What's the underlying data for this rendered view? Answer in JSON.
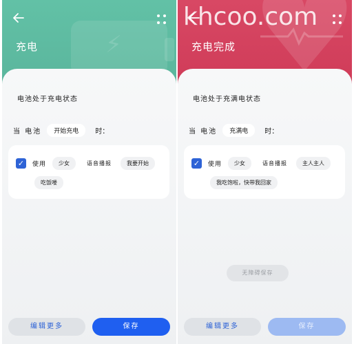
{
  "screens": [
    {
      "title": "充电",
      "state_text": "电池处于充电状态",
      "condition": {
        "prefix": "当 电池",
        "value": "开始充电",
        "suffix": "时："
      },
      "action": {
        "checked": true,
        "use_label": "使用",
        "voice": "少女",
        "mode": "语音播报",
        "message_part1": "我要开始",
        "message_part2": "吃饭喽"
      },
      "toast": "",
      "buttons": {
        "edit": "编辑更多",
        "save": "保存"
      }
    },
    {
      "title": "充电完成",
      "state_text": "电池处于充满电状态",
      "condition": {
        "prefix": "当 电池",
        "value": "充满电",
        "suffix": "时："
      },
      "action": {
        "checked": true,
        "use_label": "使用",
        "voice": "少女",
        "mode": "语音播报",
        "message_part1": "主人主人",
        "message_part2": "我吃饱啦，快带我回家"
      },
      "toast": "无障碍保存",
      "buttons": {
        "edit": "编辑更多",
        "save": "保存"
      }
    }
  ],
  "watermark": "khcoo.com",
  "icons": {
    "back": "back-arrow-icon",
    "more": "more-dots-icon",
    "check": "check-icon"
  },
  "colors": {
    "left_header": "#5ab59c",
    "right_header": "#cf3b58",
    "accent": "#1f5ff0"
  }
}
